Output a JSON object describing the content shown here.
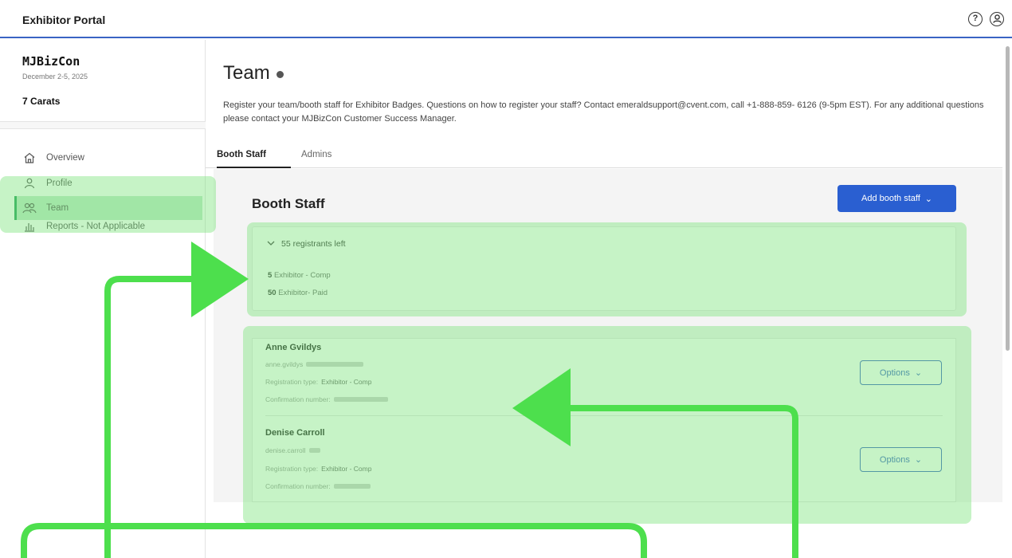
{
  "app": {
    "title": "Exhibitor Portal",
    "help_icon": "help-circle-icon",
    "account_icon": "user-circle-icon"
  },
  "sidebar": {
    "event_name": "MJBizCon",
    "event_dates": "December 2-5, 2025",
    "company": "7 Carats",
    "items": [
      {
        "label": "Overview",
        "icon": "home-icon"
      },
      {
        "label": "Profile",
        "icon": "user-icon"
      },
      {
        "label": "Team",
        "icon": "users-icon"
      },
      {
        "label": "Reports - Not Applicable",
        "icon": "bar-chart-icon"
      }
    ]
  },
  "page": {
    "title": "Team",
    "description": "Register your team/booth staff for Exhibitor Badges. Questions on how to register your staff? Contact emeraldsupport@cvent.com, call +1-888-859- 6126 (9-5pm EST). For any additional questions please contact your  MJBizCon Customer Success Manager.",
    "tabs": [
      {
        "label": "Booth Staff",
        "active": true
      },
      {
        "label": "Admins",
        "active": false
      }
    ]
  },
  "booth_staff": {
    "section_title": "Booth Staff",
    "add_button": "Add booth staff",
    "registrants_left": "55 registrants left",
    "allocations": [
      {
        "count": "5",
        "label": "Exhibitor - Comp"
      },
      {
        "count": "50",
        "label": "Exhibitor- Paid"
      }
    ],
    "staff": [
      {
        "name": "Anne Gvildys",
        "email": "anne.gvildys",
        "registration_type_label": "Registration type:",
        "registration_type": "Exhibitor - Comp",
        "confirmation_label": "Confirmation number:",
        "options_label": "Options"
      },
      {
        "name": "Denise Carroll",
        "email": "denise.carroll",
        "registration_type_label": "Registration type:",
        "registration_type": "Exhibitor - Comp",
        "confirmation_label": "Confirmation number:",
        "options_label": "Options"
      }
    ]
  },
  "colors": {
    "accent": "#2a5fd1",
    "highlight": "#59e05a",
    "nav_active_bar": "#27a35a"
  }
}
